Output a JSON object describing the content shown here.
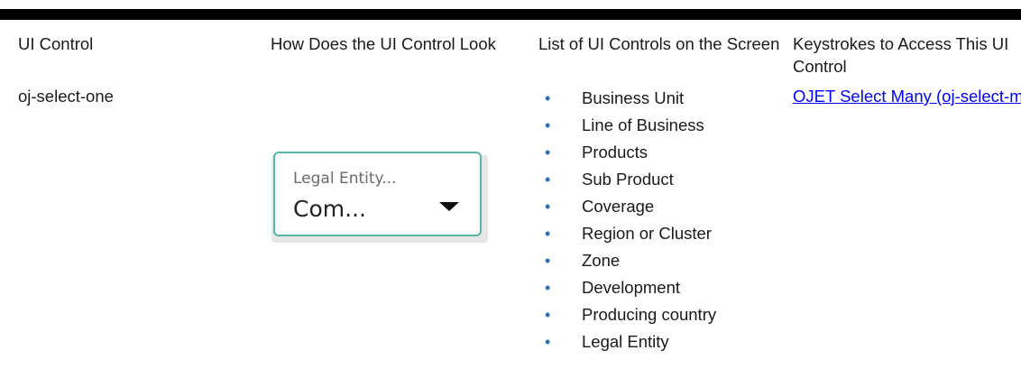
{
  "table": {
    "headers": [
      "UI Control",
      "How Does the UI Control Look",
      "List of UI Controls on the Screen",
      "Keystrokes to Access This UI Control"
    ],
    "row": {
      "control_name": "oj-select-one",
      "select_preview": {
        "label": "Legal Entity...",
        "value": "Com...",
        "icon": "chevron-down-icon"
      },
      "ui_controls": [
        "Business Unit",
        "Line of Business",
        "Products",
        "Sub Product",
        "Coverage",
        "Region or Cluster",
        "Zone",
        "Development",
        "Producing country",
        "Legal Entity"
      ],
      "keystrokes_link": "OJET Select Many (oj-select-many)"
    }
  },
  "colors": {
    "bullet": "#2d6fb2",
    "link": "#0000ee",
    "select_border": "#5ab4a7"
  }
}
